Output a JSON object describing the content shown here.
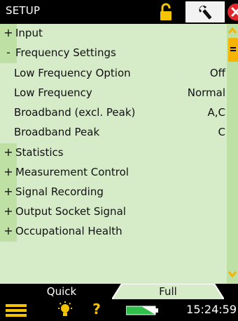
{
  "titlebar": {
    "title": "SETUP"
  },
  "menu": {
    "input": {
      "sign": "+",
      "label": "Input"
    },
    "frequency_settings": {
      "sign": "-",
      "label": "Frequency Settings"
    },
    "low_frequency_option": {
      "label": "Low Frequency Option",
      "value": "Off"
    },
    "low_frequency": {
      "label": "Low Frequency",
      "value": "Normal"
    },
    "broadband": {
      "label": "Broadband (excl. Peak)",
      "value": "A,C"
    },
    "broadband_peak": {
      "label": "Broadband Peak",
      "value": "C"
    },
    "statistics": {
      "sign": "+",
      "label": "Statistics"
    },
    "measurement_control": {
      "sign": "+",
      "label": "Measurement Control"
    },
    "signal_recording": {
      "sign": "+",
      "label": "Signal Recording"
    },
    "output_socket_signal": {
      "sign": "+",
      "label": "Output Socket Signal"
    },
    "occupational_health": {
      "sign": "+",
      "label": "Occupational Health"
    }
  },
  "tabs": {
    "quick": "Quick",
    "full": "Full"
  },
  "statusbar": {
    "clock": "15:24:59",
    "help": "?"
  },
  "icons": {
    "lock": "lock-icon",
    "tools": "wrench-icon",
    "close": "close-icon",
    "menu": "menu-icon",
    "backlight": "backlight-icon",
    "battery": "battery-icon"
  },
  "colors": {
    "panel": "#d6ebc8",
    "sign_column": "#bfe0a5",
    "accent": "#f5b400",
    "close": "#e0262b"
  }
}
